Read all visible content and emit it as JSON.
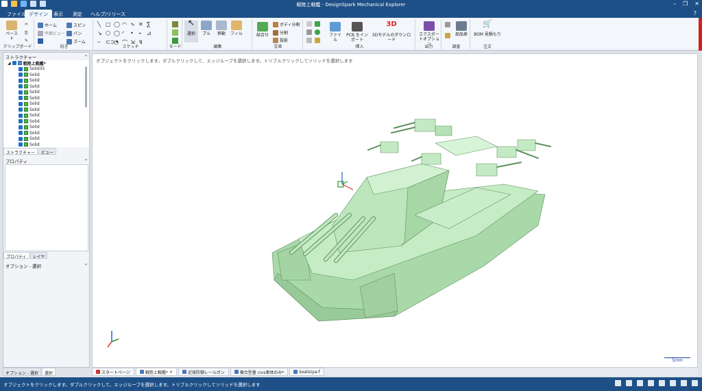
{
  "window": {
    "title": "戦陸上戦艦 - DesignSpark  Mechanical  Explorer"
  },
  "tabs": [
    "ファイル",
    "デザイン",
    "表示",
    "測定",
    "ヘルプ/リリース"
  ],
  "active_tab": 1,
  "ribbon": {
    "clipboard": {
      "label": "クリップボード",
      "paste": "ペースト"
    },
    "orient": {
      "label": "向き",
      "home": "ホーム",
      "spin": "スピン",
      "plan_view": "平面ビュー",
      "pan": "パン",
      "zoom": "ズーム"
    },
    "sketch": {
      "label": "スケッチ"
    },
    "mode": {
      "label": "モード"
    },
    "edit": {
      "label": "編集",
      "select": "選択",
      "pull": "プル",
      "move": "移動",
      "fill": "フィル"
    },
    "intersect": {
      "label": "交差",
      "combine": "結合せ",
      "split_body": "ボディ分割",
      "split": "分割",
      "project": "投影"
    },
    "insert": {
      "label": "挿入",
      "file": "ファイル",
      "pcb": "PCB をインポート",
      "model_dl": "3Dモデルのダウンロード"
    },
    "output": {
      "label": "出力",
      "export": "エクスポートオプション"
    },
    "investigate": {
      "label": "調査",
      "parts": "部品表"
    },
    "order": {
      "label": "注文",
      "bom": "BOM 見積もり"
    }
  },
  "structure": {
    "title": "ストラクチャー",
    "root": "戦陸上戦艦*",
    "items": [
      "Solid35",
      "Solid",
      "Solid",
      "Solid",
      "Solid",
      "Solid",
      "Solid",
      "Solid",
      "Solid",
      "Solid",
      "Solid",
      "Solid",
      "Solid",
      "Solid"
    ],
    "tabs": [
      "ストラクチャー",
      "ビュー"
    ]
  },
  "properties": {
    "title": "プロパティ",
    "tabs": [
      "プロパティ",
      "レイヤ"
    ]
  },
  "options": {
    "title": "オプション - 選択"
  },
  "bottom_tabs": [
    "オプション - 選択",
    "選択"
  ],
  "viewport": {
    "hint": "オブジェクトをクリックします。ダブルクリックして、エッジループを選択します。トリプルクリックしてソリッドを選択します",
    "scale": "5mm"
  },
  "doc_tabs": [
    "スタートページ",
    "戦陸上戦艦*",
    "近接防御レールガン",
    "複合型量 civs車体のみ*",
    "koalisiya-f"
  ],
  "status": {
    "message": "オブジェクトをクリックします。ダブルクリックして、エッジループを選択します。トリプルクリックしてソリッドを選択します"
  },
  "colors": {
    "accent": "#1e4f86",
    "model": "#b9e4b9",
    "model_edge": "#5f8f5f"
  }
}
